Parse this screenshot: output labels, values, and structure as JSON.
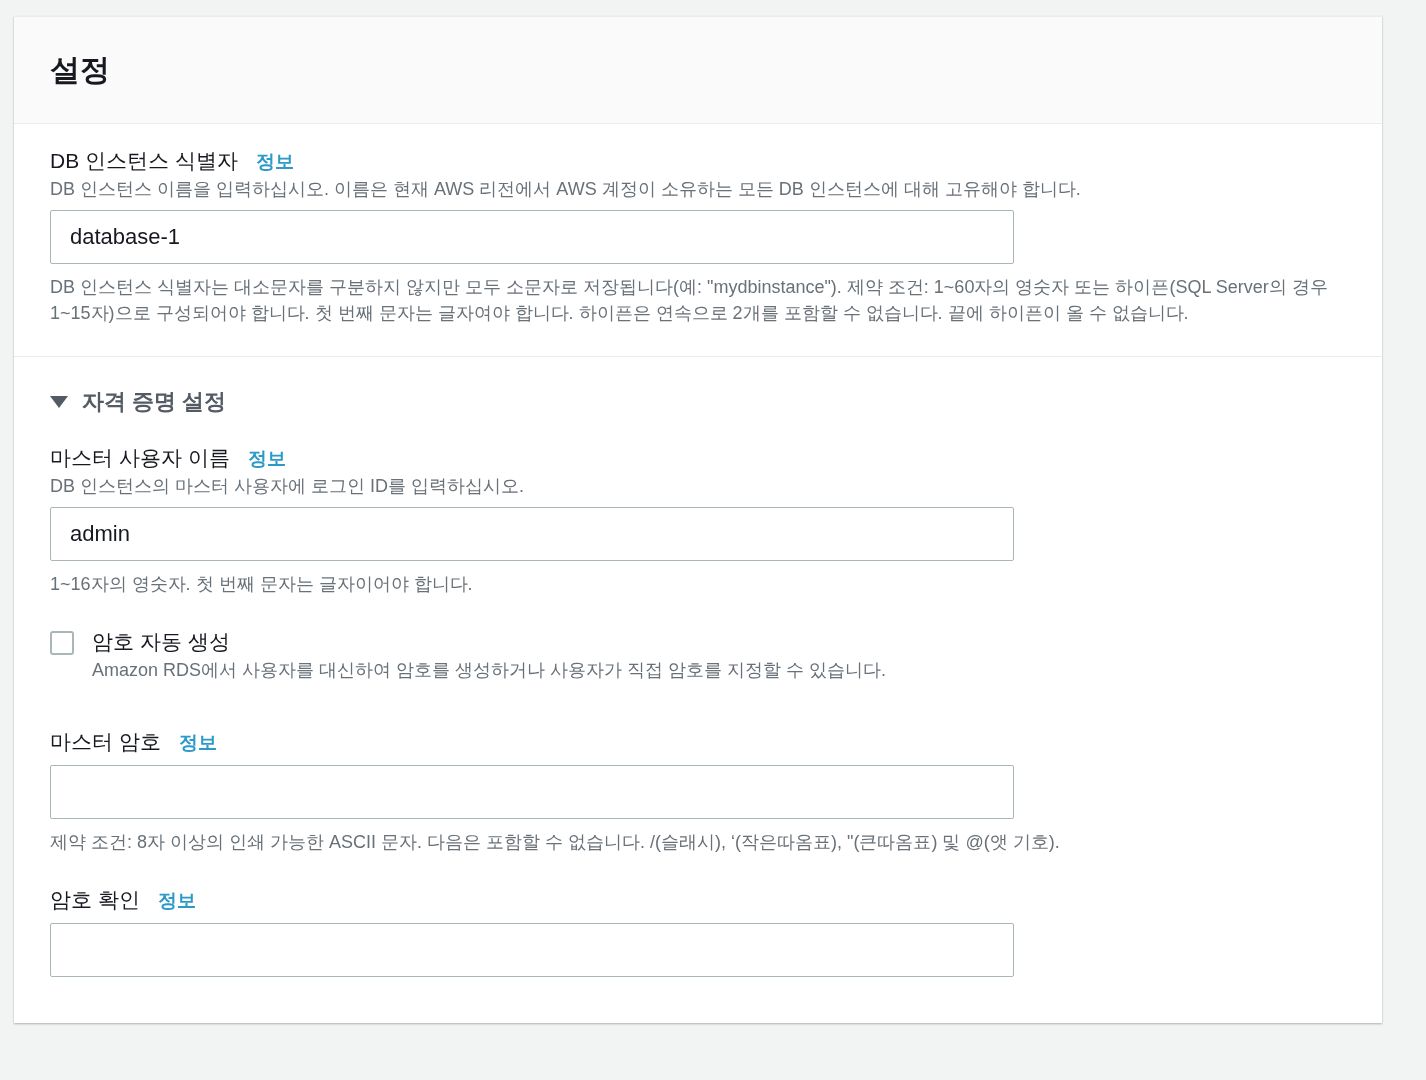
{
  "panel": {
    "title": "설정"
  },
  "sections": [
    {
      "kind": "plain",
      "fields": [
        {
          "kind": "input",
          "label": "DB 인스턴스 식별자",
          "info": "정보",
          "description": "DB 인스턴스 이름을 입력하십시오. 이름은 현재 AWS 리전에서 AWS 계정이 소유하는 모든 DB 인스턴스에 대해 고유해야 합니다.",
          "value": "database-1",
          "constraint": "DB 인스턴스 식별자는 대소문자를 구분하지 않지만 모두 소문자로 저장됩니다(예: \"mydbinstance\"). 제약 조건: 1~60자의 영숫자 또는 하이픈(SQL Server의 경우 1~15자)으로 구성되어야 합니다. 첫 번째 문자는 글자여야 합니다. 하이픈은 연속으로 2개를 포함할 수 없습니다. 끝에 하이픈이 올 수 없습니다."
        }
      ]
    },
    {
      "kind": "expandable",
      "heading": "자격 증명 설정",
      "expanded": true,
      "fields": [
        {
          "kind": "input",
          "label": "마스터 사용자 이름",
          "info": "정보",
          "description": "DB 인스턴스의 마스터 사용자에 로그인 ID를 입력하십시오.",
          "value": "admin",
          "constraint": "1~16자의 영숫자. 첫 번째 문자는 글자이어야 합니다."
        },
        {
          "kind": "checkbox",
          "label": "암호 자동 생성",
          "description": "Amazon RDS에서 사용자를 대신하여 암호를 생성하거나 사용자가 직접 암호를 지정할 수 있습니다.",
          "checked": false
        },
        {
          "kind": "input",
          "label": "마스터 암호",
          "info": "정보",
          "constraint": "제약 조건: 8자 이상의 인쇄 가능한 ASCII 문자. 다음은 포함할 수 없습니다. /(슬래시), ‘(작은따옴표), \"(큰따옴표) 및 @(앳 기호)."
        },
        {
          "kind": "input",
          "label": "암호 확인",
          "info": "정보"
        }
      ]
    }
  ]
}
